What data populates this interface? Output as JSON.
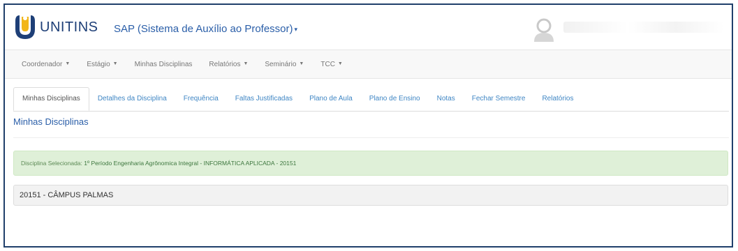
{
  "header": {
    "logo_text": "UNITINS",
    "app_title": "SAP (Sistema de Auxílio ao Professor)"
  },
  "menu": {
    "items": [
      {
        "label": "Coordenador",
        "dropdown": true
      },
      {
        "label": "Estágio",
        "dropdown": true
      },
      {
        "label": "Minhas Disciplinas",
        "dropdown": false
      },
      {
        "label": "Relatórios",
        "dropdown": true
      },
      {
        "label": "Seminário",
        "dropdown": true
      },
      {
        "label": "TCC",
        "dropdown": true
      }
    ]
  },
  "tabs": {
    "items": [
      {
        "label": "Minhas Disciplinas",
        "active": true
      },
      {
        "label": "Detalhes da Disciplina",
        "active": false
      },
      {
        "label": "Frequência",
        "active": false
      },
      {
        "label": "Faltas Justificadas",
        "active": false
      },
      {
        "label": "Plano de Aula",
        "active": false
      },
      {
        "label": "Plano de Ensino",
        "active": false
      },
      {
        "label": "Notas",
        "active": false
      },
      {
        "label": "Fechar Semestre",
        "active": false
      },
      {
        "label": "Relatórios",
        "active": false
      }
    ]
  },
  "main": {
    "section_title": "Minhas Disciplinas",
    "alert": {
      "label": "Disciplina Selecionada:",
      "value": "1º Período Engenharia Agrônomica Integral - INFORMÁTICA APLICADA - 20151"
    },
    "panel_heading": "20151 - CÂMPUS PALMAS"
  },
  "colors": {
    "brand_blue": "#1e3f77",
    "link_blue": "#3f86c4",
    "logo_yellow": "#f2b619",
    "success_bg": "#dff0d8"
  }
}
